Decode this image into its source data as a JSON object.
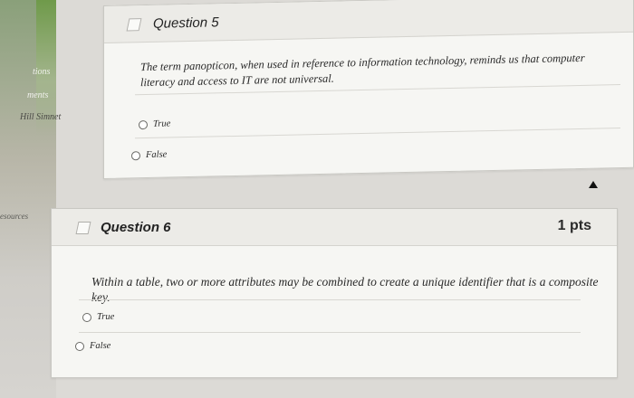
{
  "sidebar": {
    "items": [
      {
        "label": "tions"
      },
      {
        "label": "ments"
      },
      {
        "label": "Hill Simnet"
      },
      {
        "label": "esources"
      }
    ]
  },
  "q5": {
    "title": "Question 5",
    "text": "The term panopticon, when used in reference to information technology, reminds us that computer literacy and access to IT are not universal.",
    "options": [
      "True",
      "False"
    ]
  },
  "q6": {
    "title": "Question 6",
    "points": "1 pts",
    "text": "Within a table, two or more attributes may be combined to create a unique identifier that is a composite key.",
    "options": [
      "True",
      "False"
    ]
  }
}
